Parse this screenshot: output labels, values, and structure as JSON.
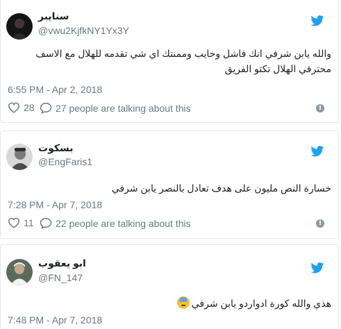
{
  "tweets": [
    {
      "author_name": "سنايبر",
      "author_handle": "@vwu2KjfkNY1Yx3Y",
      "avatar_icon": "dark-profile-photo",
      "text": "والله يابن شرفي انك فاشل وخايب وممنتك اي شي تقدمه للهلال مع الاسف محترفي الهلال تكتو الفريق",
      "timestamp": "6:55 PM - Apr 2, 2018",
      "likes": "28",
      "talking": "27 people are talking about this"
    },
    {
      "author_name": "بسكوت",
      "author_handle": "@EngFaris1",
      "avatar_icon": "grayscale-profile-photo",
      "text": "خسارة النص مليون على هدف تعادل بالنصر يابن شرفي",
      "timestamp": "7:28 PM - Apr 7, 2018",
      "likes": "11",
      "talking": "22 people are talking about this"
    },
    {
      "author_name": "ابو يعقوب",
      "author_handle": "@FN_147",
      "avatar_icon": "profile-photo",
      "text": "هذي والله كورة ادواردو يابن شرفي",
      "emoji": "downcast-face-with-sweat-emoji",
      "timestamp": "7:48 PM - Apr 7, 2018"
    }
  ],
  "icons": {
    "bird": "twitter-bird-icon",
    "like": "heart-icon",
    "reply": "speech-bubble-icon",
    "info": "info-icon"
  },
  "colors": {
    "bird_blue": "#1da1f2",
    "meta_gray": "#697882",
    "text": "#1c2022",
    "border": "#e1e8ed"
  }
}
